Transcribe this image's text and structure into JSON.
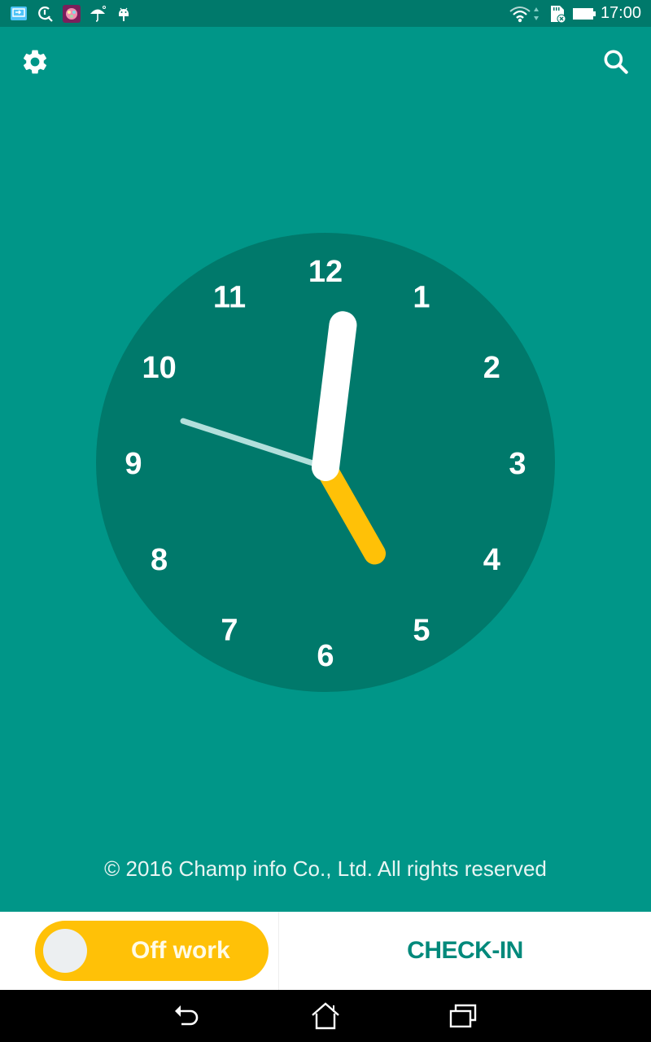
{
  "status_bar": {
    "time": "17:00",
    "left_icons": [
      "screen-cast-icon",
      "sync-tool-icon",
      "app-grid-icon",
      "umbrella-icon",
      "android-icon"
    ],
    "right_icons": [
      "wifi-icon",
      "data-arrows-icon",
      "sd-card-error-icon",
      "battery-icon"
    ]
  },
  "app_bar": {
    "left_icon": "settings-gear-icon",
    "right_icon": "search-icon"
  },
  "clock": {
    "time_shown": "17:00",
    "hour": 5,
    "minute": 0.5,
    "second": 48,
    "numerals": [
      "12",
      "1",
      "2",
      "3",
      "4",
      "5",
      "6",
      "7",
      "8",
      "9",
      "10",
      "11"
    ],
    "colors": {
      "face": "#00796b",
      "numerals": "#ffffff",
      "hour_hand": "#ffc107",
      "minute_hand": "#ffffff",
      "second_hand": "#b2dfdb"
    }
  },
  "footer": {
    "copyright": "© 2016 Champ info Co., Ltd. All rights reserved"
  },
  "bottom_bar": {
    "toggle_label": "Off work",
    "toggle_state": "off",
    "checkin_label": "CHECK-IN"
  },
  "nav_bar": {
    "buttons": [
      "back-icon",
      "home-icon",
      "recent-apps-icon"
    ]
  },
  "colors": {
    "primary": "#009688",
    "primary_dark": "#00796b",
    "accent": "#ffc107",
    "checkin_text": "#00897b"
  }
}
